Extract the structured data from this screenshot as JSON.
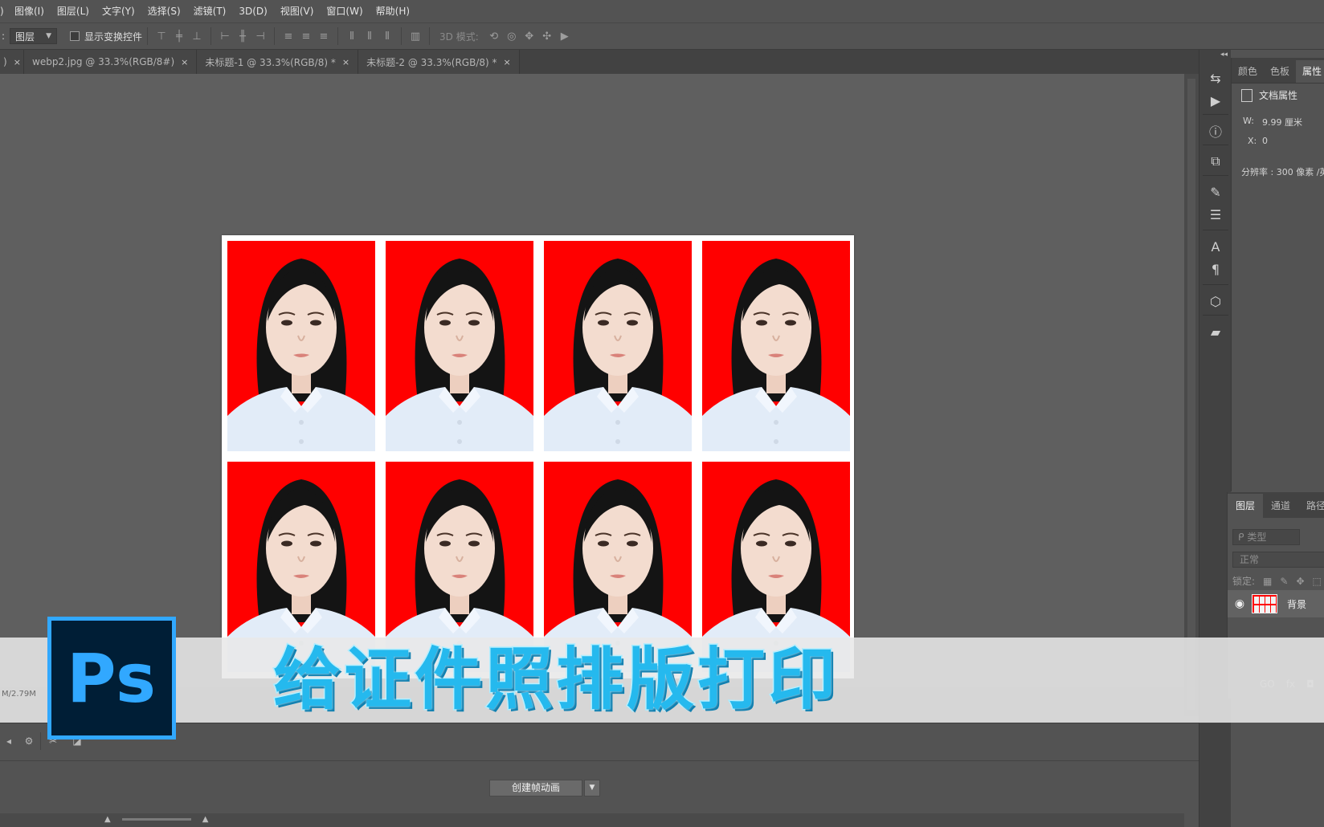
{
  "menubar": {
    "lead": ")",
    "items": [
      "图像(I)",
      "图层(L)",
      "文字(Y)",
      "选择(S)",
      "滤镜(T)",
      "3D(D)",
      "视图(V)",
      "窗口(W)",
      "帮助(H)"
    ]
  },
  "options": {
    "colon": ":",
    "auto_select_value": "图层",
    "show_transform_label": "显示变换控件",
    "mode3d_label": "3D 模式:"
  },
  "tabs": [
    {
      "label": ")"
    },
    {
      "label": "webp2.jpg @ 33.3%(RGB/8#)"
    },
    {
      "label": "未标题-1 @ 33.3%(RGB/8) *"
    },
    {
      "label": "未标题-2 @ 33.3%(RGB/8) *"
    }
  ],
  "tab_close": "×",
  "document": {
    "rows": 2,
    "cols": 4,
    "background_color": "#ff0000"
  },
  "properties": {
    "tabs": [
      "颜色",
      "色板",
      "属性"
    ],
    "active_tab": "属性",
    "header": "文档属性",
    "width_label": "W:",
    "width_value": "9.99 厘米",
    "x_label": "X:",
    "x_value": "0",
    "resolution": "分辨率 : 300 像素 /英"
  },
  "layers": {
    "tabs": [
      "图层",
      "通道",
      "路径"
    ],
    "filter_placeholder": "ᑭ 类型",
    "blend_mode": "正常",
    "lock_label": "锁定:",
    "layer_name": "背景",
    "footer": [
      "GO",
      "fx",
      "◘"
    ]
  },
  "timeline": {
    "create_button": "创建帧动画",
    "status": "M/2.79M"
  },
  "banner": {
    "logo_text": "Ps",
    "title": "给证件照排版打印"
  },
  "colors": {
    "accent": "#31a8ff",
    "logo_bg": "#001e36",
    "title": "#25b9ee"
  }
}
